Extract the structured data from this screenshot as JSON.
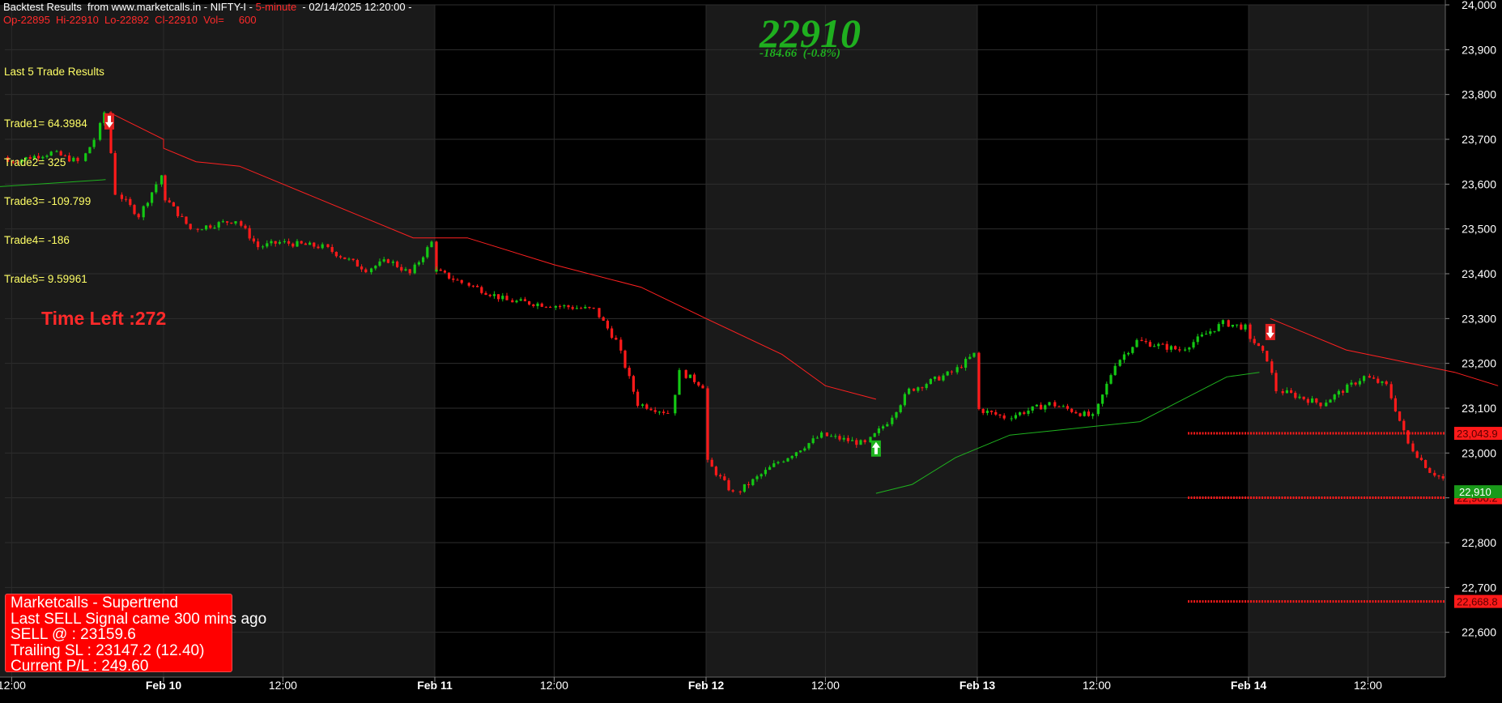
{
  "header": {
    "line1_a": "Backtest Results  from www.marketcalls.in - NIFTY-I - ",
    "line1_b": "5-minute",
    "line1_c": "  - 02/14/2025 12:20:00 - ",
    "line2": "Op-22895  Hi-22910  Lo-22892  Cl-22910  Vol=     600"
  },
  "price_display": {
    "last": "22910",
    "change": "-184.66  (-0.8%)"
  },
  "trade_results": {
    "title": "Last 5 Trade Results",
    "trades": [
      "Trade1= 64.3984",
      "Trade2= 325",
      "Trade3= -109.799",
      "Trade4= -186",
      "Trade5= 9.59961"
    ]
  },
  "time_left": "Time Left :272",
  "info_box": {
    "line1": "Marketcalls - Supertrend",
    "line2": "Last SELL Signal came 300 mins ago",
    "line3": "SELL @ : 23159.6",
    "line4": "Trailing SL : 23147.2 (12.40)",
    "line5": "Current P/L : 249.60"
  },
  "colors": {
    "background": "#000000",
    "band_alt": "#1a1a1a",
    "up": "#14c814",
    "down": "#ff1a1a",
    "trend_down": "#ff2020",
    "trend_up": "#1fb31f",
    "text_yellow": "#ffff66",
    "text_red": "#ff2a2a",
    "price_green": "#1faf1f",
    "axis_text": "#ffffff"
  },
  "chart_data": {
    "type": "candlestick",
    "symbol": "NIFTY-I",
    "interval": "5-minute",
    "ylim": [
      22500,
      24000
    ],
    "yticks": [
      22600,
      22700,
      22800,
      22900,
      23000,
      23100,
      23200,
      23300,
      23400,
      23500,
      23600,
      23700,
      23800,
      23900,
      24000
    ],
    "ytick_labels": [
      "22,600",
      "22,700",
      "22,800",
      "22,900",
      "23,000",
      "23,100",
      "23,200",
      "23,300",
      "23,400",
      "23,500",
      "23,600",
      "23,700",
      "23,800",
      "23,900",
      "24,000"
    ],
    "x_labels": [
      "12:00",
      "Feb 10",
      "12:00",
      "Feb 11",
      "12:00",
      "Feb 12",
      "12:00",
      "Feb 13",
      "12:00",
      "Feb 14",
      "12:00"
    ],
    "price_path": [
      [
        "Feb 07 09:15",
        23660
      ],
      [
        "Feb 07 10:00",
        23640
      ],
      [
        "Feb 07 11:00",
        23665
      ],
      [
        "Feb 07 12:00",
        23650
      ],
      [
        "Feb 07 13:00",
        23670
      ],
      [
        "Feb 07 13:40",
        23650
      ],
      [
        "Feb 07 14:00",
        23700
      ],
      [
        "Feb 07 14:15",
        23760
      ],
      [
        "Feb 07 14:30",
        23580
      ],
      [
        "Feb 07 15:00",
        23530
      ],
      [
        "Feb 07 15:25",
        23600
      ],
      [
        "Feb 07 15:30",
        23620
      ],
      [
        "Feb 10 09:15",
        23580
      ],
      [
        "Feb 10 10:00",
        23500
      ],
      [
        "Feb 10 11:00",
        23520
      ],
      [
        "Feb 10 11:30",
        23460
      ],
      [
        "Feb 10 12:00",
        23470
      ],
      [
        "Feb 10 13:00",
        23460
      ],
      [
        "Feb 10 14:00",
        23410
      ],
      [
        "Feb 10 14:30",
        23430
      ],
      [
        "Feb 10 15:00",
        23400
      ],
      [
        "Feb 10 15:30",
        23470
      ],
      [
        "Feb 11 09:15",
        23410
      ],
      [
        "Feb 11 10:00",
        23380
      ],
      [
        "Feb 11 11:00",
        23340
      ],
      [
        "Feb 11 12:00",
        23330
      ],
      [
        "Feb 11 13:00",
        23320
      ],
      [
        "Feb 11 13:30",
        23250
      ],
      [
        "Feb 11 14:00",
        23110
      ],
      [
        "Feb 11 14:45",
        23090
      ],
      [
        "Feb 11 15:00",
        23180
      ],
      [
        "Feb 11 15:30",
        23150
      ],
      [
        "Feb 12 09:15",
        22990
      ],
      [
        "Feb 12 10:00",
        22910
      ],
      [
        "Feb 12 11:00",
        22980
      ],
      [
        "Feb 12 12:00",
        23040
      ],
      [
        "Feb 12 13:00",
        23020
      ],
      [
        "Feb 12 13:30",
        23070
      ],
      [
        "Feb 12 14:00",
        23140
      ],
      [
        "Feb 12 15:00",
        23180
      ],
      [
        "Feb 12 15:30",
        23220
      ],
      [
        "Feb 13 09:15",
        23100
      ],
      [
        "Feb 13 10:00",
        23080
      ],
      [
        "Feb 13 11:00",
        23110
      ],
      [
        "Feb 13 12:00",
        23080
      ],
      [
        "Feb 13 12:30",
        23200
      ],
      [
        "Feb 13 13:00",
        23250
      ],
      [
        "Feb 13 14:00",
        23230
      ],
      [
        "Feb 13 15:00",
        23290
      ],
      [
        "Feb 13 15:30",
        23280
      ],
      [
        "Feb 14 09:15",
        23270
      ],
      [
        "Feb 14 09:45",
        23210
      ],
      [
        "Feb 14 10:00",
        23140
      ],
      [
        "Feb 14 11:00",
        23110
      ],
      [
        "Feb 14 12:00",
        23170
      ],
      [
        "Feb 14 12:30",
        23150
      ],
      [
        "Feb 14 13:00",
        23020
      ],
      [
        "Feb 14 13:30",
        22960
      ],
      [
        "Feb 14 14:00",
        22930
      ],
      [
        "Feb 14 14:30",
        22980
      ],
      [
        "Feb 14 15:00",
        22925
      ],
      [
        "Feb 14 15:20",
        22910
      ]
    ],
    "supertrend_down_1": [
      [
        "Feb 07 14:15",
        23760
      ],
      [
        "Feb 07 15:30",
        23700
      ],
      [
        "Feb 10 09:15",
        23680
      ],
      [
        "Feb 10 10:00",
        23650
      ],
      [
        "Feb 10 11:00",
        23640
      ],
      [
        "Feb 10 12:00",
        23600
      ],
      [
        "Feb 10 14:00",
        23520
      ],
      [
        "Feb 10 15:00",
        23480
      ],
      [
        "Feb 11 10:00",
        23480
      ],
      [
        "Feb 11 12:00",
        23420
      ],
      [
        "Feb 11 14:00",
        23370
      ],
      [
        "Feb 11 15:30",
        23300
      ],
      [
        "Feb 12 11:00",
        23220
      ],
      [
        "Feb 12 12:00",
        23150
      ],
      [
        "Feb 12 13:10",
        23120
      ]
    ],
    "supertrend_up_1": [
      [
        "Feb 07 09:15",
        23580
      ],
      [
        "Feb 07 11:00",
        23590
      ],
      [
        "Feb 07 14:10",
        23610
      ]
    ],
    "supertrend_up_2": [
      [
        "Feb 12 13:10",
        22910
      ],
      [
        "Feb 12 14:00",
        22930
      ],
      [
        "Feb 12 15:00",
        22990
      ],
      [
        "Feb 13 10:00",
        23040
      ],
      [
        "Feb 13 11:00",
        23050
      ],
      [
        "Feb 13 12:00",
        23060
      ],
      [
        "Feb 13 13:00",
        23070
      ],
      [
        "Feb 13 14:00",
        23120
      ],
      [
        "Feb 13 15:00",
        23170
      ],
      [
        "Feb 14 09:30",
        23180
      ]
    ],
    "supertrend_down_2": [
      [
        "Feb 14 09:45",
        23300
      ],
      [
        "Feb 14 10:30",
        23270
      ],
      [
        "Feb 14 11:30",
        23230
      ],
      [
        "Feb 14 12:30",
        23210
      ],
      [
        "Feb 14 13:00",
        23200
      ],
      [
        "Feb 14 14:00",
        23180
      ],
      [
        "Feb 14 15:00",
        23150
      ]
    ],
    "signals": [
      {
        "type": "buy",
        "time": "Feb 07 09:15",
        "price": 23640
      },
      {
        "type": "sell",
        "time": "Feb 07 14:15",
        "price": 23740
      },
      {
        "type": "buy",
        "time": "Feb 12 13:10",
        "price": 23010
      },
      {
        "type": "sell",
        "time": "Feb 14 09:45",
        "price": 23270
      }
    ],
    "levels": [
      {
        "label": "23,043.9",
        "value": 23043.9,
        "color": "#ff1a1a",
        "style": "dotted"
      },
      {
        "label": "22,900.2",
        "value": 22900.2,
        "color": "#ff1a1a",
        "style": "dotted"
      },
      {
        "label": "22,668.8",
        "value": 22668.8,
        "color": "#ff1a1a",
        "style": "dotted"
      }
    ],
    "last_price_label": "22,910"
  }
}
